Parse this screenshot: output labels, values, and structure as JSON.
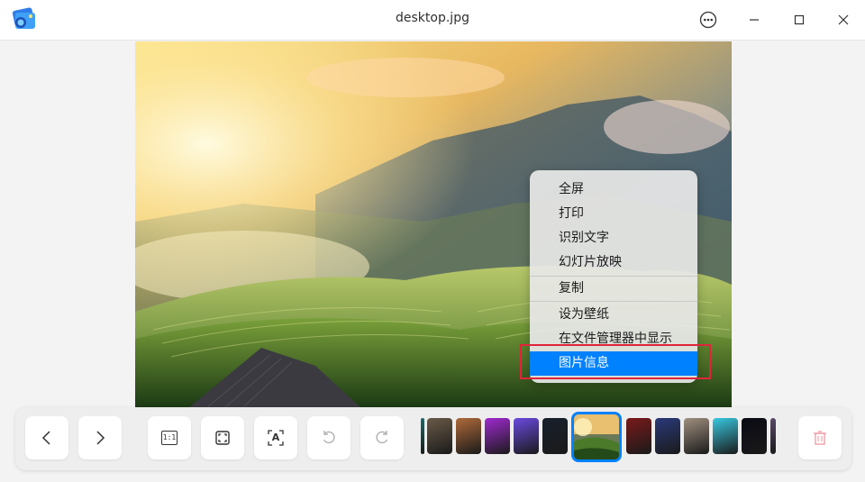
{
  "window": {
    "title": "desktop.jpg",
    "controls": {
      "menu_icon": "more-options-icon",
      "minimize_icon": "minimize-icon",
      "maximize_icon": "maximize-icon",
      "close_icon": "close-icon"
    }
  },
  "context_menu": {
    "items": [
      {
        "label": "全屏"
      },
      {
        "label": "打印"
      },
      {
        "label": "识别文字"
      },
      {
        "label": "幻灯片放映"
      },
      {
        "label": "复制"
      },
      {
        "label": "设为壁纸"
      },
      {
        "label": "在文件管理器中显示"
      },
      {
        "label": "图片信息"
      }
    ],
    "selected_index": 7,
    "highlight_color": "#0081ff",
    "annotation_color": "#e0243a"
  },
  "toolbar": {
    "buttons": [
      {
        "icon": "previous-icon"
      },
      {
        "icon": "next-icon"
      },
      {
        "icon": "original-size-icon"
      },
      {
        "icon": "fit-window-icon"
      },
      {
        "icon": "ocr-icon"
      },
      {
        "icon": "rotate-left-icon"
      },
      {
        "icon": "rotate-right-icon"
      },
      {
        "icon": "delete-icon"
      }
    ],
    "ocr_glyph": "A",
    "one_to_one_glyph": "1:1",
    "thumbnails": [
      {
        "color": "#1a6b6b"
      },
      {
        "color": "#6a5a48"
      },
      {
        "color": "#b06a3a"
      },
      {
        "color": "#a02ad0"
      },
      {
        "color": "#6a4ae0"
      },
      {
        "color": "#18202c"
      },
      {
        "color": "#7a1a1a"
      },
      {
        "color": "#2a3a7a"
      },
      {
        "color": "#a09080"
      },
      {
        "color": "#38c8e0"
      },
      {
        "color": "#0a0a14"
      },
      {
        "color": "#5a4a6a"
      }
    ],
    "current_thumbnail": "desktop.jpg"
  }
}
